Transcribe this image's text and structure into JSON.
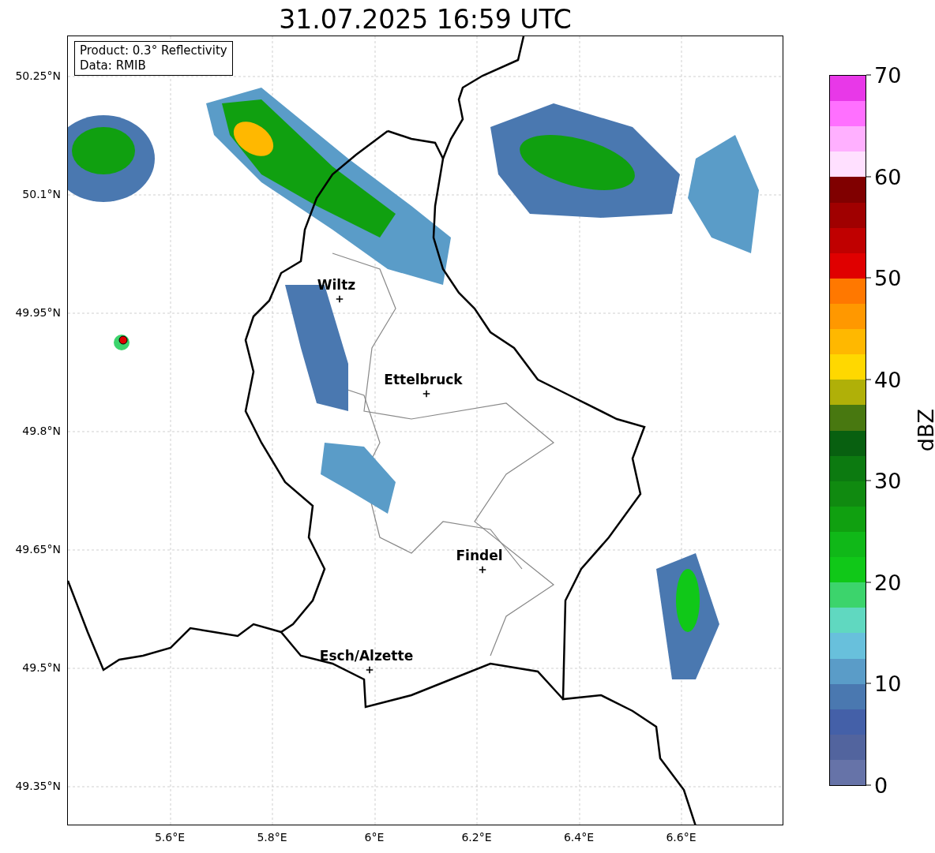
{
  "title": "31.07.2025 16:59 UTC",
  "info_box": [
    "Product: 0.3° Reflectivity",
    "Data: RMIB"
  ],
  "map": {
    "y_ticks": [
      "50.25°N",
      "50.1°N",
      "49.95°N",
      "49.8°N",
      "49.65°N",
      "49.5°N",
      "49.35°N"
    ],
    "x_ticks": [
      "5.6°E",
      "5.8°E",
      "6°E",
      "6.2°E",
      "6.4°E",
      "6.6°E"
    ],
    "cities": [
      {
        "name": "Wiltz"
      },
      {
        "name": "Ettelbruck"
      },
      {
        "name": "Findel"
      },
      {
        "name": "Esch/Alzette"
      }
    ]
  },
  "colorbar": {
    "label": "dBZ",
    "ticks": [
      "70",
      "60",
      "50",
      "40",
      "30",
      "20",
      "10",
      "0"
    ],
    "bins": [
      {
        "color": "#e838e8"
      },
      {
        "color": "#ff70ff"
      },
      {
        "color": "#ffb0ff"
      },
      {
        "color": "#ffe0ff"
      },
      {
        "color": "#800000"
      },
      {
        "color": "#a00000"
      },
      {
        "color": "#c00000"
      },
      {
        "color": "#e00000"
      },
      {
        "color": "#ff7800"
      },
      {
        "color": "#ff9800"
      },
      {
        "color": "#ffb800"
      },
      {
        "color": "#ffd800"
      },
      {
        "color": "#b0b008"
      },
      {
        "color": "#487810"
      },
      {
        "color": "#086010"
      },
      {
        "color": "#0c7a10"
      },
      {
        "color": "#108a10"
      },
      {
        "color": "#10a010"
      },
      {
        "color": "#10b818"
      },
      {
        "color": "#10c818"
      },
      {
        "color": "#3cd46c"
      },
      {
        "color": "#60d8c0"
      },
      {
        "color": "#68c0dc"
      },
      {
        "color": "#5a9cc8"
      },
      {
        "color": "#4a78b0"
      },
      {
        "color": "#4460a8"
      },
      {
        "color": "#52649e"
      },
      {
        "color": "#6673a8"
      }
    ]
  }
}
